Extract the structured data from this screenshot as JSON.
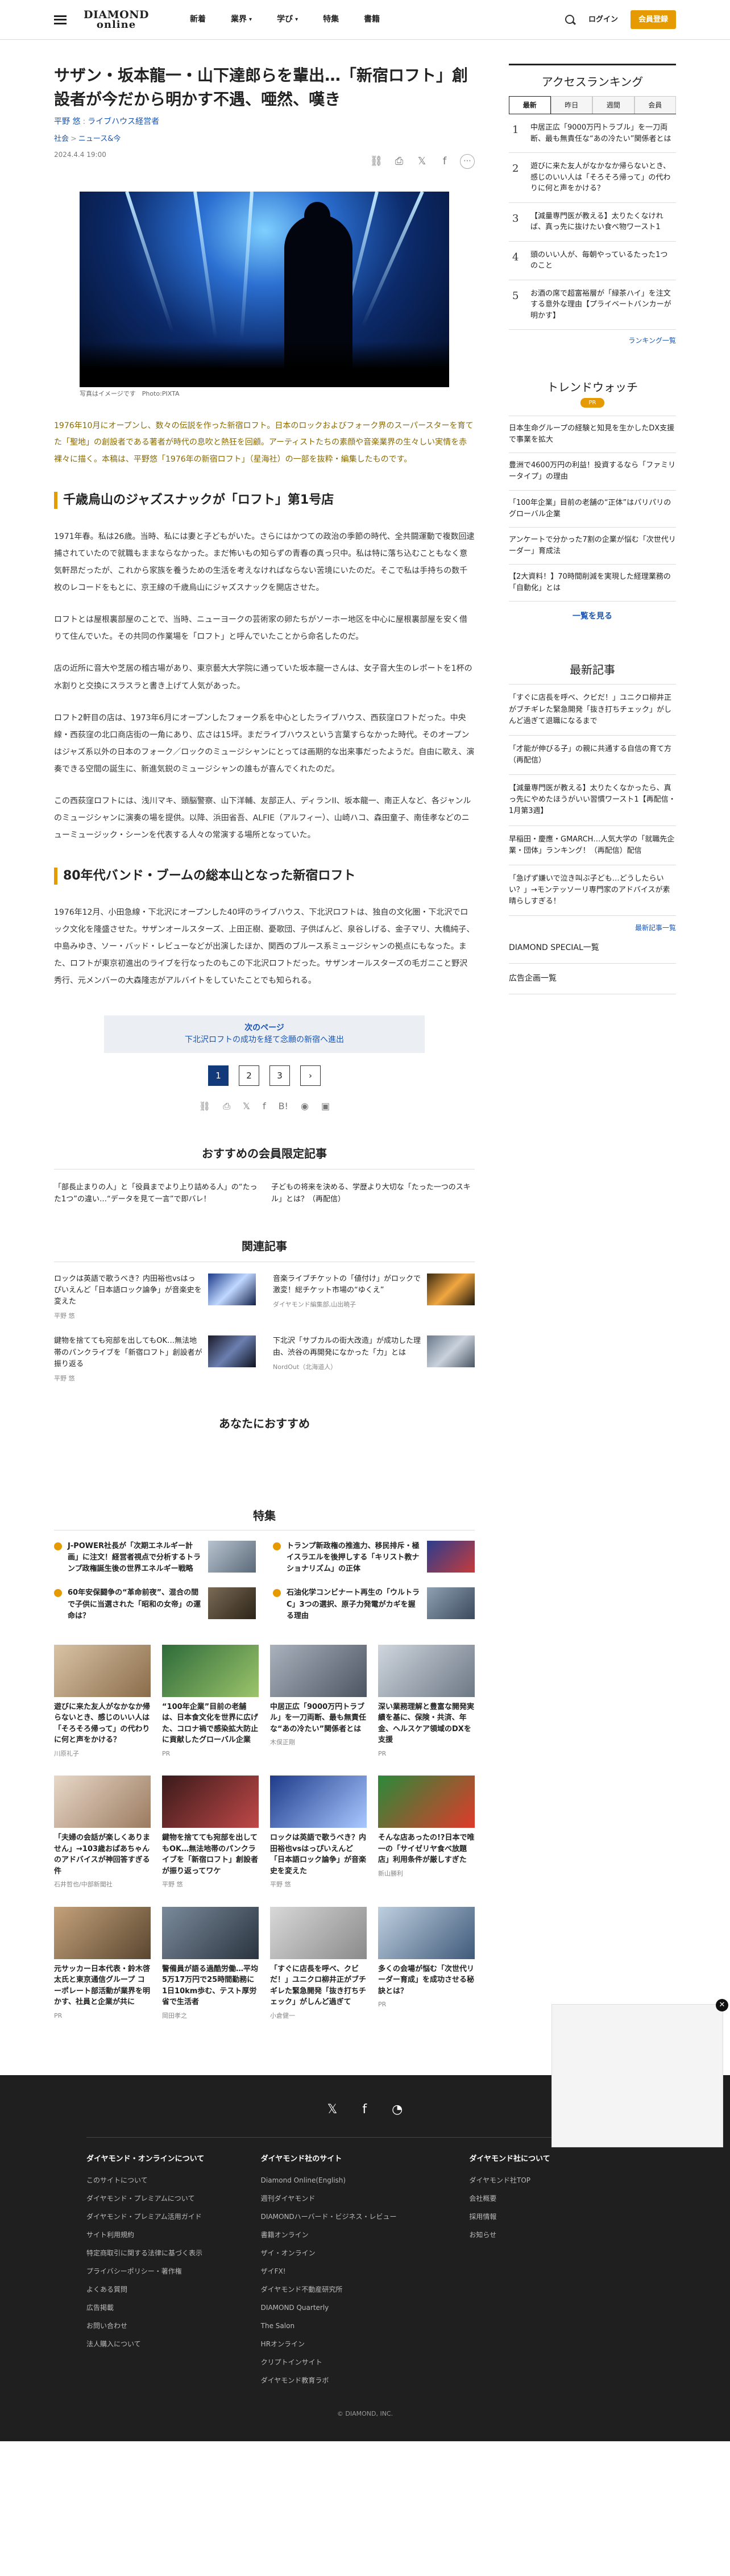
{
  "header": {
    "logo_line1": "DIAMOND",
    "logo_line2": "online",
    "nav": [
      {
        "label": "新着",
        "caret": ""
      },
      {
        "label": "業界",
        "caret": "▾"
      },
      {
        "label": "学び",
        "caret": "▾"
      },
      {
        "label": "特集",
        "caret": ""
      },
      {
        "label": "書籍",
        "caret": ""
      }
    ],
    "login": "ログイン",
    "signup": "会員登録"
  },
  "article": {
    "title": "サザン・坂本龍一・山下達郎らを輩出…「新宿ロフト」創設者が今だから明かす不遇、唖然、嘆き",
    "author": "平野 悠",
    "author_role": "ライブハウス経営者",
    "category1": "社会",
    "category2": "ニュース&今",
    "date": "2024.4.4 19:00",
    "hero_caption": "写真はイメージです　Photo:PIXTA",
    "lead": "1976年10月にオープンし、数々の伝説を作った新宿ロフト。日本のロックおよびフォーク界のスーパースターを育てた「聖地」の創設者である著者が時代の息吹と熱狂を回顧。アーティストたちの素顔や音楽業界の生々しい実情を赤裸々に描く。本稿は、平野悠「1976年の新宿ロフト」（星海社）の一部を抜粋・編集したものです。",
    "section1": "千歳烏山のジャズスナックが「ロフト」第1号店",
    "p1": "1971年春。私は26歳。当時、私には妻と子どもがいた。さらにはかつての政治の季節の時代、全共闘運動で複数回逮捕されていたので就職もままならなかった。まだ怖いもの知らずの青春の真っ只中。私は特に落ち込むこともなく意気軒昂だったが、これから家族を養うための生活を考えなければならない苦境にいたのだ。そこで私は手持ちの数千枚のレコードをもとに、京王線の千歳烏山にジャズスナックを開店させた。",
    "p2": "ロフトとは屋根裏部屋のことで、当時、ニューヨークの芸術家の卵たちがソーホー地区を中心に屋根裏部屋を安く借りて住んでいた。その共同の作業場を「ロフト」と呼んでいたことから命名したのだ。",
    "p3": "店の近所に音大や芝居の稽古場があり、東京藝大大学院に通っていた坂本龍一さんは、女子音大生のレポートを1杯の水割りと交換にスラスラと書き上げて人気があった。",
    "p4": "ロフト2軒目の店は、1973年6月にオープンしたフォーク系を中心としたライブハウス、西荻窪ロフトだった。中央線・西荻窪の北口商店街の一角にあり、広さは15坪。まだライブハウスという言葉すらなかった時代。そのオープンはジャズ系以外の日本のフォーク／ロックのミュージシャンにとっては画期的な出来事だったようだ。自由に歌え、演奏できる空間の誕生に、新進気鋭のミュージシャンの誰もが喜んでくれたのだ。",
    "p5": "この西荻窪ロフトには、浅川マキ、頭脳警察、山下洋輔、友部正人、ディランII、坂本龍一、南正人など、各ジャンルのミュージシャンに演奏の場を提供。以降、浜田省吾、ALFIE（アルフィー）、山崎ハコ、森田童子、南佳孝などのニューミュージック・シーンを代表する人々の常演する場所となっていた。",
    "section2": "80年代バンド・ブームの総本山となった新宿ロフト",
    "p6": "1976年12月、小田急線・下北沢にオープンした40坪のライブハウス、下北沢ロフトは、独自の文化圏・下北沢でロック文化を隆盛させた。サザンオールスターズ、上田正樹、憂歌団、子供ばんど、泉谷しげる、金子マリ、大橋純子、中島みゆき、ソー・バッド・レビューなどが出演したほか、関西のブルース系ミュージシャンの拠点にもなった。また、ロフトが東京初進出のライブを行なったのもこの下北沢ロフトだった。サザンオールスターズの毛ガニこと野沢秀行、元メンバーの大森隆志がアルバイトをしていたことでも知られる。",
    "next_label": "次のページ",
    "next_title": "下北沢ロフトの成功を経て念願の新宿へ進出",
    "pages": [
      "1",
      "2",
      "3",
      "›"
    ]
  },
  "member": {
    "heading": "おすすめの会員限定記事",
    "items": [
      "「部長止まりの人」と「役員までより上り詰める人」の“たった1つ”の違い…“データを見て一言”で即バレ！",
      "子どもの将来を決める、学歴より大切な「たった一つのスキル」とは？（再配信）"
    ]
  },
  "related": {
    "heading": "関連記事",
    "items": [
      {
        "title": "ロックは英語で歌うべき？内田裕也vsはっぴいえんど「日本語ロック論争」が音楽史を変えた",
        "by": "平野 悠"
      },
      {
        "title": "音楽ライブチケットの「値付け」がロックで激変！総チケット市場の“ゆくえ”",
        "by": "ダイヤモンド編集部,山出暁子"
      },
      {
        "title": "鍵物を捨てても宛部を出してもOK…無法地帯のパンクライブを「新宿ロフト」創設者が振り返る",
        "by": "平野 悠"
      },
      {
        "title": "下北沢「サブカルの街大改造」が成功した理由、渋谷の再開発になかった「力」とは",
        "by": "NordOut（北海道人）"
      }
    ]
  },
  "recommend_heading": "あなたにおすすめ",
  "tokushu": {
    "heading": "特集",
    "items": [
      "J-POWER社長が「次期エネルギー計画」に注文！経営者視点で分析するトランプ政権誕生後の世界エネルギー戦略",
      "トランプ新政権の推進力、移民排斥・極イスラエルを後押しする「キリスト教ナショナリズム」の正体",
      "60年安保闘争の“革命前夜”、混合の間で子供に当選された「昭和の女帝」の運命は？",
      "石油化学コンビナート再生の「ウルトラC」3つの選択、原子力発電がカギを握る理由"
    ]
  },
  "tiles": [
    {
      "title": "遊びに来た友人がなかなか帰らないとき、感じのいい人は「そろそろ帰って」の代わりに何と声をかける？",
      "by": "川原礼子"
    },
    {
      "title": "“100年企業”目前の老舗は、日本食文化を世界に広げた、コロナ禍で感染拡大防止に貢献したグローバル企業",
      "by": "PR"
    },
    {
      "title": "中居正広「9000万円トラブル」を一刀両断、最も無責任な“あの冷たい”関係者とは",
      "by": "木俣正剛"
    },
    {
      "title": "深い業務理解と豊富な開発実績を基に、保険・共済、年金、ヘルスケア領域のDXを支援",
      "by": "PR"
    },
    {
      "title": "「夫婦の会話が楽しくありません」→103歳おばあちゃんのアドバイスが神回答すぎる件",
      "by": "石井哲也/中部新聞社"
    },
    {
      "title": "鍵物を捨てても宛部を出してもOK…無法地帯のパンクライブを「新宿ロフト」創設者が振り返ってワケ",
      "by": "平野 悠"
    },
    {
      "title": "ロックは英語で歌うべき？内田裕也vsはっぴいえんど「日本語ロック論争」が音楽史を変えた",
      "by": "平野 悠"
    },
    {
      "title": "そんな店あったの!?日本で唯一の「サイゼリヤ食べ放題店」利用条件が厳しすぎた",
      "by": "新山勝利"
    },
    {
      "title": "元サッカー日本代表・鈴木啓太氏と東京通信グループ コーポレート部活動が業界を明かす、社員と企業が共に",
      "by": "PR"
    },
    {
      "title": "警備員が語る過酷労働…平均5万17万円で25時間勤務に1日10km歩む、テスト厚労省で生活者",
      "by": "岡田孝之"
    },
    {
      "title": "「すぐに店長を呼べ、クビだ！」ユニクロ柳井正がブチギレた緊急開発「抜き打ちチェック」がしんど過ぎて",
      "by": "小倉健一"
    },
    {
      "title": "多くの会場が悩む「次世代リーダー育成」を成功させる秘訣とは？",
      "by": "PR"
    }
  ],
  "sidebar": {
    "ranking_heading": "アクセスランキング",
    "ranking_tabs": [
      "最新",
      "昨日",
      "週間",
      "会員"
    ],
    "ranking": [
      "中居正広「9000万円トラブル」を一刀両断、最も無責任な“あの冷たい”関係者とは",
      "遊びに来た友人がなかなか帰らないとき、感じのいい人は「そろそろ帰って」の代わりに何と声をかける？",
      "【減量専門医が教える】太りたくなければ、真っ先に抜けたい食べ物ワースト1",
      "頭のいい人が、毎朝やっているたった1つのこと",
      "お酒の席で超富裕層が「緑茶ハイ」を注文する意外な理由【プライベートバンカーが明かす】"
    ],
    "ranking_more": "ランキング一覧",
    "trend_heading": "トレンドウォッチ",
    "trend_badge": "PR",
    "trends": [
      "日本生命グループの経験と知見を生かしたDX支援で事業を拡大",
      "豊洲で4600万円の利益！投資するなら「ファミリータイプ」の理由",
      "「100年企業」目前の老舗の“正体”はパリパリのグローバル企業",
      "アンケートで分かった7割の企業が悩む「次世代リーダー」育成法",
      "【2大資料！】70時間削減を実現した経理業務の「自動化」とは"
    ],
    "trend_more": "一覧を見る",
    "latest_heading": "最新記事",
    "latest": [
      "「すぐに店長を呼べ、クビだ！」ユニクロ柳井正がブチギレた緊急開発「抜き打ちチェック」がしんど過ぎて退職になるまで",
      "「才能が伸びる子」の親に共通する自信の育て方（再配信）",
      "【減量専門医が教える】太りたくなかったら、真っ先にやめたほうがいい習慣ワースト1【再配信・1月第3週】",
      "早稲田・慶應・GMARCH…人気大学の「就職先企業・団体」ランキング！（再配信）配信",
      "「急げず嫌いで泣き叫ぶ子ども…どうしたらいい？」→モンテッソーリ専門家のアドバイスが素晴らしすぎる！"
    ],
    "latest_more": "最新記事一覧",
    "links": [
      "DIAMOND SPECIAL一覧",
      "広告企画一覧"
    ]
  },
  "footer": {
    "col1_heading": "ダイヤモンド・オンラインについて",
    "col1": [
      "このサイトについて",
      "ダイヤモンド・プレミアムについて",
      "ダイヤモンド・プレミアム活用ガイド",
      "サイト利用規約",
      "特定商取引に関する法律に基づく表示",
      "プライバシーポリシー・著作権",
      "よくある質問",
      "広告掲載",
      "お問い合わせ",
      "法人購入について"
    ],
    "col2_heading": "ダイヤモンド社のサイト",
    "col2": [
      "Diamond Online(English)",
      "週刊ダイヤモンド",
      "DIAMONDハーバード・ビジネス・レビュー",
      "書籍オンライン",
      "ザイ・オンライン",
      "ザイFX!",
      "ダイヤモンド不動産研究所",
      "DIAMOND Quarterly",
      "The Salon",
      "HRオンライン",
      "クリプトインサイト",
      "ダイヤモンド教育ラボ"
    ],
    "col3_heading": "ダイヤモンド社について",
    "col3": [
      "ダイヤモンド社TOP",
      "会社概要",
      "採用情報",
      "お知らせ"
    ],
    "copyright": "© DIAMOND, INC."
  }
}
